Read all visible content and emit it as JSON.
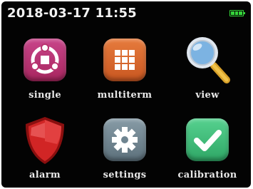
{
  "status": {
    "datetime": "2018-03-17 11:55",
    "battery_color": "#35d43a"
  },
  "apps": [
    {
      "label": "single",
      "icon": "single-target-icon",
      "color": "#b8336e"
    },
    {
      "label": "multiterm",
      "icon": "grid-icon",
      "color": "#d9672f"
    },
    {
      "label": "view",
      "icon": "magnifier-icon",
      "color": "#6aa9d8"
    },
    {
      "label": "alarm",
      "icon": "shield-icon",
      "color": "#c81d1d"
    },
    {
      "label": "settings",
      "icon": "gear-icon",
      "color": "#6f8591"
    },
    {
      "label": "calibration",
      "icon": "checkmark-icon",
      "color": "#3fbf7a"
    }
  ]
}
